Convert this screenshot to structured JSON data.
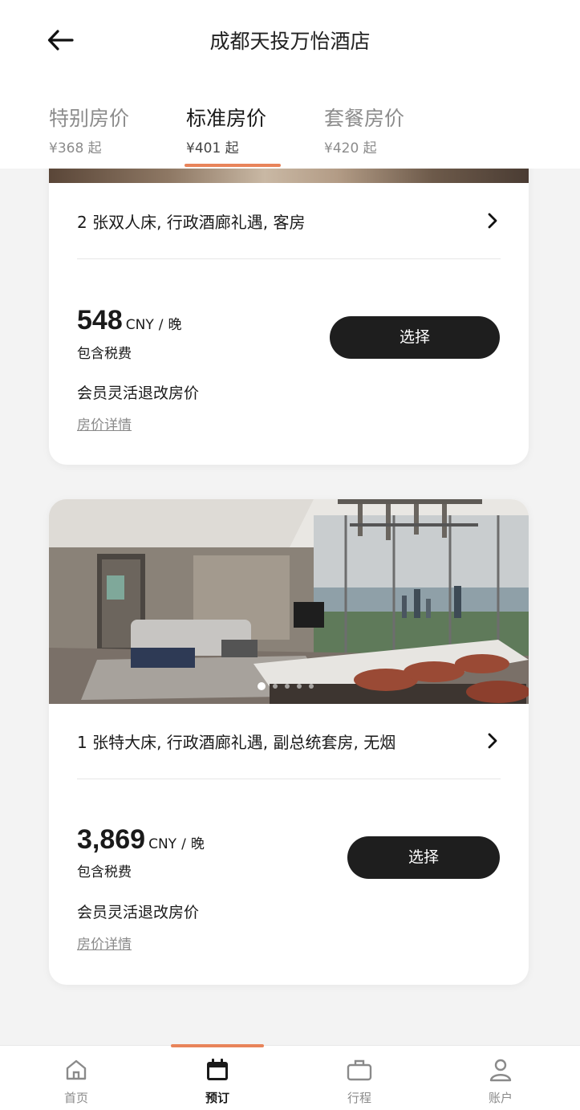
{
  "header": {
    "title": "成都天投万怡酒店",
    "back_icon": "arrow-left-icon"
  },
  "tabs": [
    {
      "label": "特别房价",
      "price": "¥368 起",
      "active": false
    },
    {
      "label": "标准房价",
      "price": "¥401 起",
      "active": true
    },
    {
      "label": "套餐房价",
      "price": "¥420 起",
      "active": false
    }
  ],
  "rooms": [
    {
      "name": "2 张双人床, 行政酒廊礼遇, 客房",
      "price": "548",
      "currency": "CNY",
      "slash": "/",
      "per": "晚",
      "tax_note": "包含税费",
      "policy": "会员灵活退改房价",
      "details_link": "房价详情",
      "select_label": "选择"
    },
    {
      "name": "1 张特大床, 行政酒廊礼遇, 副总统套房, 无烟",
      "price": "3,869",
      "currency": "CNY",
      "slash": "/",
      "per": "晚",
      "tax_note": "包含税费",
      "policy": "会员灵活退改房价",
      "details_link": "房价详情",
      "select_label": "选择",
      "photo_count": 5,
      "photo_active_index": 0
    }
  ],
  "bottom_nav": [
    {
      "label": "首页",
      "icon": "home-icon",
      "active": false
    },
    {
      "label": "预订",
      "icon": "calendar-icon",
      "active": true
    },
    {
      "label": "行程",
      "icon": "briefcase-icon",
      "active": false
    },
    {
      "label": "账户",
      "icon": "user-icon",
      "active": false
    }
  ],
  "colors": {
    "accent": "#e8845a",
    "button": "#1e1e1e",
    "background": "#f3f3f3"
  }
}
